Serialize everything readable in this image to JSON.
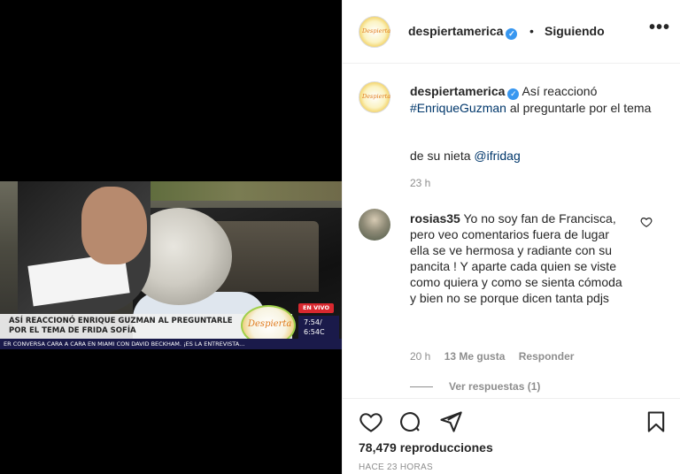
{
  "video": {
    "headline": "ASÍ REACCIONÓ ENRIQUE GUZMAN AL PREGUNTARLE POR EL TEMA DE FRIDA SOFÍA",
    "ticker": "ER CONVERSA CARA A CARA EN MIAMI CON DAVID BECKHAM. ¡ES LA ENTREVISTA...",
    "logo_text": "Despierta",
    "live_badge": "EN VIVO",
    "time_1": "7:54/",
    "time_2": "6:54C"
  },
  "header": {
    "avatar_text": "Despierta",
    "username": "despiertamerica",
    "separator": "•",
    "follow_label": "Siguiendo",
    "more_label": "•••"
  },
  "caption": {
    "avatar_text": "Despierta",
    "username": "despiertamerica",
    "text_before": "Así reaccionó",
    "hashtag": "#EnriqueGuzman",
    "text_after": "al preguntarle por el tema",
    "line2_prefix": "de su nieta",
    "mention": "@ifridag",
    "time": "23 h"
  },
  "comment": {
    "username": "rosias35",
    "text": "Yo no soy fan de Francisca, pero veo comentarios fuera de lugar ella se ve hermosa y radiante con su pancita ! Y aparte cada quien se viste como quiera y como se sienta cómoda y bien no se porque dicen tanta pdjs",
    "time": "20 h",
    "likes": "13 Me gusta",
    "reply_label": "Responder",
    "view_replies": "Ver respuestas (1)"
  },
  "footer": {
    "views": "78,479 reproducciones",
    "posted": "HACE 23 HORAS"
  },
  "icons": {
    "like": "heart-icon",
    "comment": "comment-icon",
    "share": "share-icon",
    "save": "bookmark-icon"
  },
  "colors": {
    "verified": "#3897f0",
    "link": "#00376b",
    "muted": "#8e8e8e"
  }
}
